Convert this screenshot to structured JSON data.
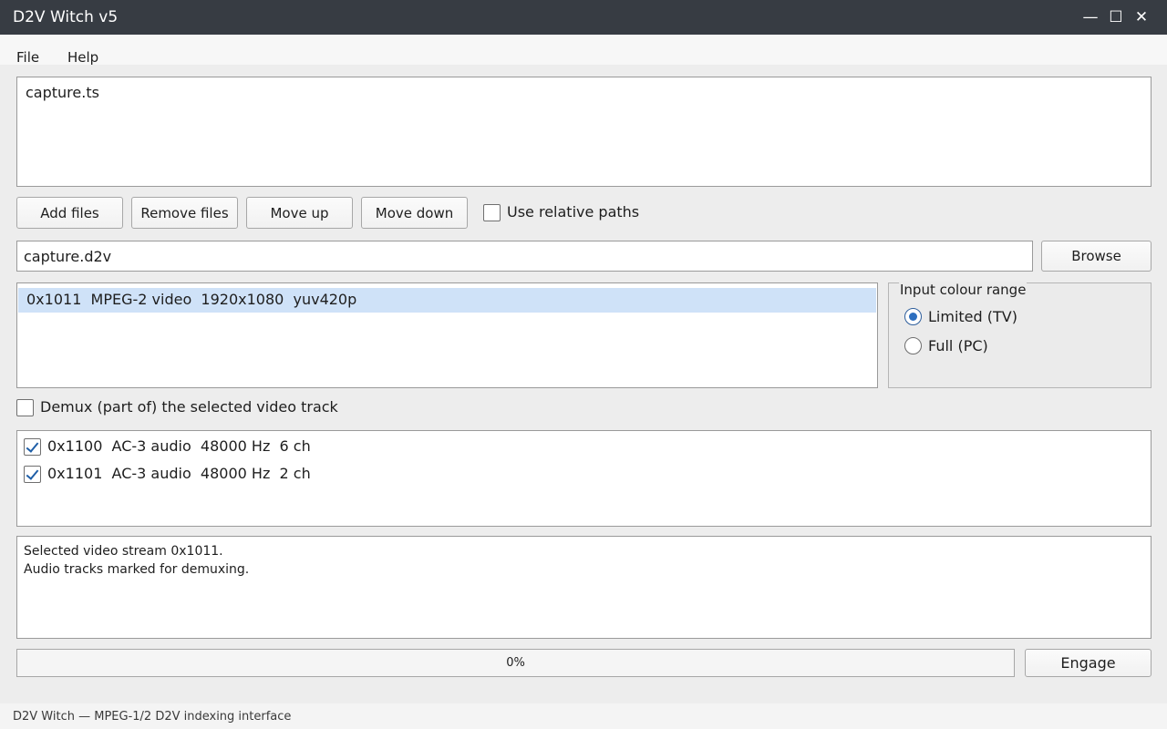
{
  "window": {
    "title": "D2V Witch v5",
    "minimize_symbol": "—",
    "maximize_symbol": "☐",
    "close_symbol": "✕"
  },
  "menu": {
    "file": "File",
    "help": "Help"
  },
  "file_list": {
    "items": [
      "capture.ts"
    ]
  },
  "buttons": {
    "add": "Add files",
    "remove": "Remove files",
    "up": "Move up",
    "down": "Move down",
    "browse": "Browse",
    "engage": "Engage"
  },
  "relative_paths": {
    "label": "Use relative paths",
    "checked": false
  },
  "output": {
    "value": "capture.d2v"
  },
  "video_tracks": {
    "items": [
      "0x1011  MPEG-2 video  1920x1080  yuv420p"
    ],
    "selected_index": 0
  },
  "colour_range": {
    "title": "Input colour range",
    "options": [
      "Limited (TV)",
      "Full (PC)"
    ],
    "selected": "Limited (TV)"
  },
  "demux_video": {
    "label": "Demux (part of) the selected video track",
    "checked": false
  },
  "audio_tracks": {
    "items": [
      {
        "label": "0x1100  AC-3 audio  48000 Hz  6 ch",
        "checked": true
      },
      {
        "label": "0x1101  AC-3 audio  48000 Hz  2 ch",
        "checked": true
      }
    ]
  },
  "log": {
    "lines": [
      "Selected video stream 0x1011.",
      "Audio tracks marked for demuxing."
    ]
  },
  "progress": {
    "text": "0%",
    "value": 0
  },
  "statusbar": {
    "text": "D2V Witch — MPEG-1/2 D2V indexing interface"
  },
  "colors": {
    "titlebar": "#373c43",
    "selection": "#cfe2f8",
    "accent": "#2e6fbf"
  }
}
